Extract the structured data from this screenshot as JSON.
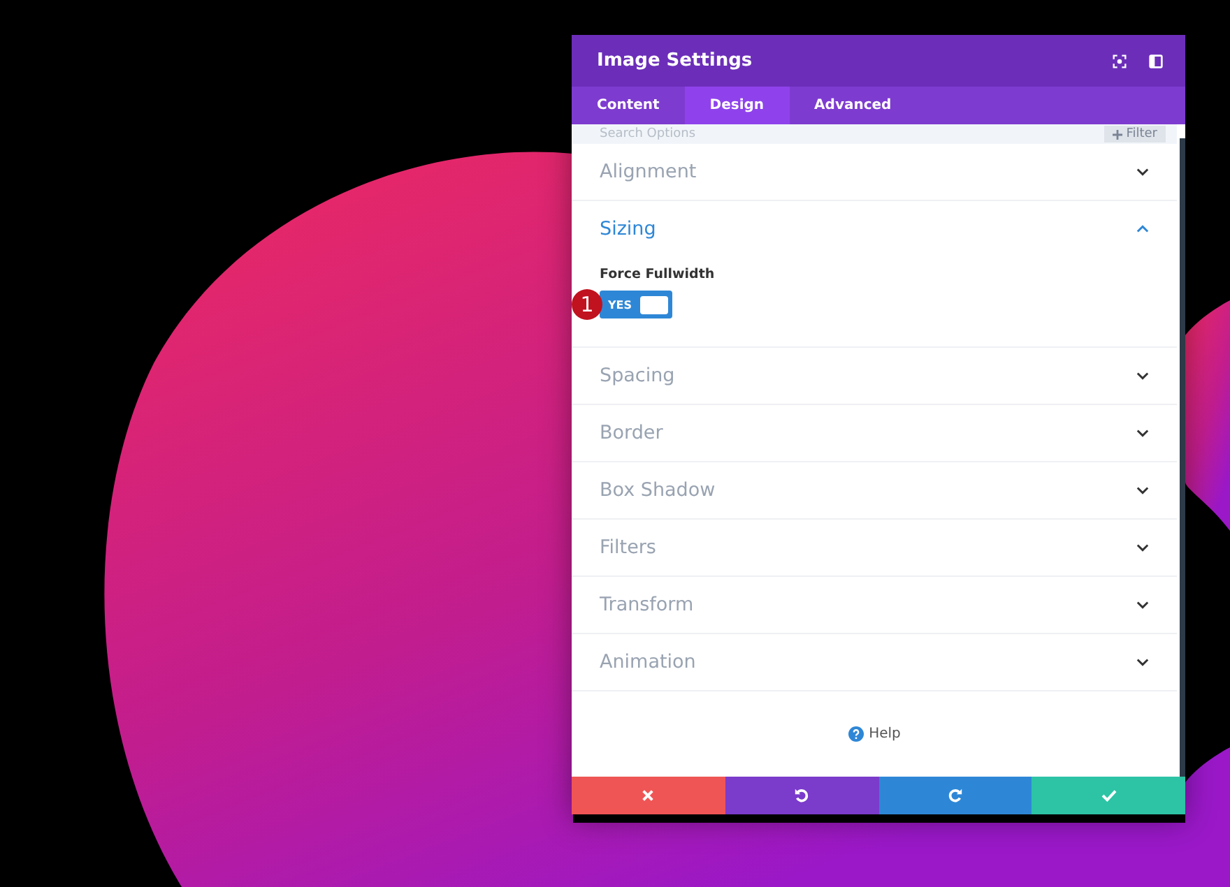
{
  "window": {
    "title": "Image Settings"
  },
  "tabs": [
    {
      "label": "Content",
      "selected": false
    },
    {
      "label": "Design",
      "selected": true
    },
    {
      "label": "Advanced",
      "selected": false
    }
  ],
  "search": {
    "placeholder": "Search Options",
    "filter_label": "Filter"
  },
  "sections": [
    {
      "title": "Alignment",
      "expanded": false
    },
    {
      "title": "Sizing",
      "expanded": true,
      "field": {
        "label": "Force Fullwidth",
        "toggle_label": "YES",
        "on": true,
        "badge": "1"
      }
    },
    {
      "title": "Spacing",
      "expanded": false
    },
    {
      "title": "Border",
      "expanded": false
    },
    {
      "title": "Box Shadow",
      "expanded": false
    },
    {
      "title": "Filters",
      "expanded": false
    },
    {
      "title": "Transform",
      "expanded": false
    },
    {
      "title": "Animation",
      "expanded": false
    }
  ],
  "help": {
    "label": "Help"
  },
  "footer": [
    {
      "kind": "cancel"
    },
    {
      "kind": "undo"
    },
    {
      "kind": "redo"
    },
    {
      "kind": "save"
    }
  ]
}
